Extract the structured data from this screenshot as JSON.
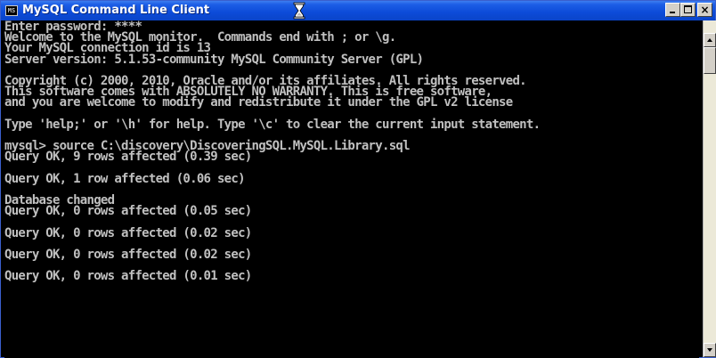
{
  "window": {
    "title": "MySQL Command Line Client",
    "icon_label": "MS"
  },
  "console": {
    "lines": [
      "Enter password: ****",
      "Welcome to the MySQL monitor.  Commands end with ; or \\g.",
      "Your MySQL connection id is 13",
      "Server version: 5.1.53-community MySQL Community Server (GPL)",
      "",
      "Copyright (c) 2000, 2010, Oracle and/or its affiliates. All rights reserved.",
      "This software comes with ABSOLUTELY NO WARRANTY. This is free software,",
      "and you are welcome to modify and redistribute it under the GPL v2 license",
      "",
      "Type 'help;' or '\\h' for help. Type '\\c' to clear the current input statement.",
      "",
      "mysql> source C:\\discovery\\DiscoveringSQL.MySQL.Library.sql",
      "Query OK, 9 rows affected (0.39 sec)",
      "",
      "Query OK, 1 row affected (0.06 sec)",
      "",
      "Database changed",
      "Query OK, 0 rows affected (0.05 sec)",
      "",
      "Query OK, 0 rows affected (0.02 sec)",
      "",
      "Query OK, 0 rows affected (0.02 sec)",
      "",
      "Query OK, 0 rows affected (0.01 sec)",
      ""
    ]
  },
  "controls": {
    "close_glyph": "×"
  },
  "icons": {
    "app": "console-icon",
    "busy": "hourglass-icon",
    "minimize": "minimize-icon",
    "maximize": "maximize-icon",
    "close": "close-icon",
    "scroll_up": "scroll-up-arrow-icon",
    "scroll_down": "scroll-down-arrow-icon"
  },
  "colors": {
    "titlebar": "#0a44c8",
    "console_bg": "#000000",
    "console_text": "#c0c0c0"
  }
}
